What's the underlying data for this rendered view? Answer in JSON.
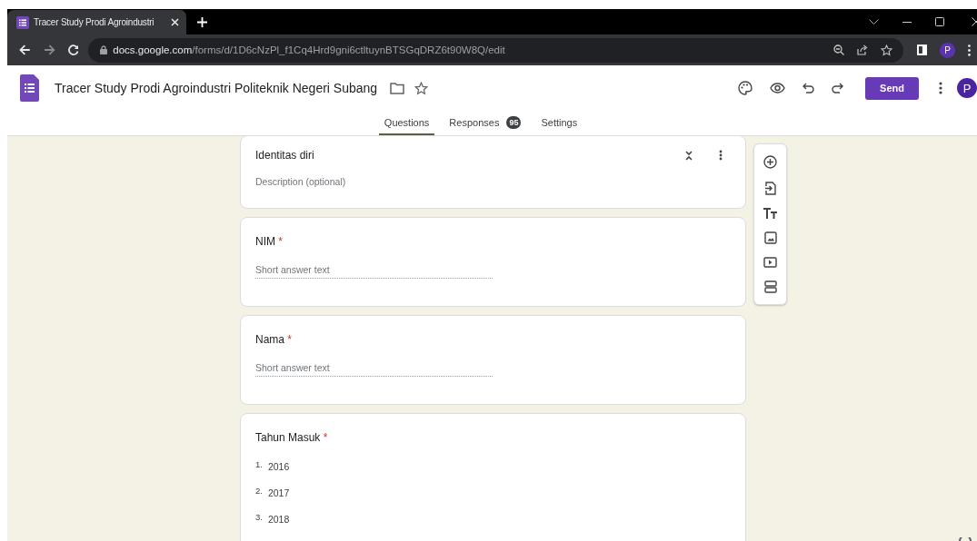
{
  "browser": {
    "tab_title": "Tracer Study Prodi Agroindustri",
    "url_host": "docs.google.com",
    "url_path": "/forms/d/1D6cNzPl_f1Cq4Hrd9gni6ctltuynBTSGqDRZ6t90W8Q/edit",
    "profile_letter": "P"
  },
  "form_header": {
    "title": "Tracer Study Prodi Agroindustri Politeknik Negeri Subang",
    "send_label": "Send",
    "avatar_letter": "P"
  },
  "tabs": [
    {
      "label": "Questions",
      "selected": true
    },
    {
      "label": "Responses",
      "selected": false,
      "badge": "95"
    },
    {
      "label": "Settings",
      "selected": false
    }
  ],
  "items": [
    {
      "kind": "section",
      "title": "Identitas diri",
      "description_placeholder": "Description (optional)"
    },
    {
      "kind": "short_answer",
      "title": "NIM",
      "required_mark": "*",
      "placeholder": "Short answer text"
    },
    {
      "kind": "short_answer",
      "title": "Nama",
      "required_mark": "*",
      "placeholder": "Short answer text"
    },
    {
      "kind": "list",
      "title": "Tahun Masuk",
      "required_mark": "*",
      "options": [
        {
          "number": "1.",
          "label": "2016"
        },
        {
          "number": "2.",
          "label": "2017"
        },
        {
          "number": "3.",
          "label": "2018"
        }
      ]
    }
  ]
}
